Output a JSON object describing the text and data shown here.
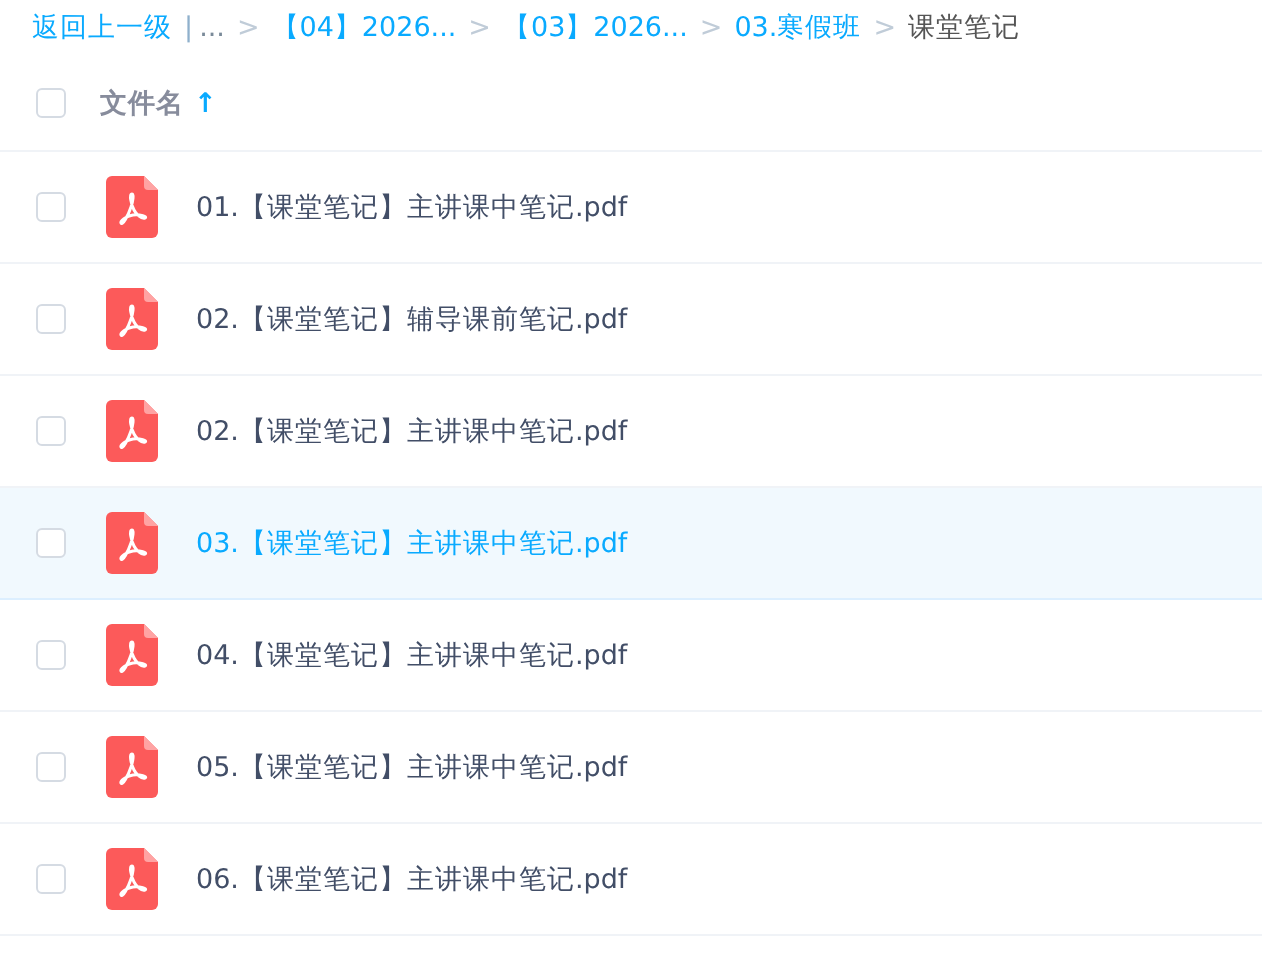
{
  "breadcrumb": [
    {
      "kind": "link",
      "text": "返回上一级"
    },
    {
      "kind": "divider",
      "text": "|"
    },
    {
      "kind": "muted",
      "text": "..."
    },
    {
      "kind": "sep",
      "text": ">"
    },
    {
      "kind": "link",
      "text": "【04】2026..."
    },
    {
      "kind": "sep",
      "text": ">"
    },
    {
      "kind": "link",
      "text": "【03】2026..."
    },
    {
      "kind": "sep",
      "text": ">"
    },
    {
      "kind": "link",
      "text": "03.寒假班"
    },
    {
      "kind": "sep",
      "text": ">"
    },
    {
      "kind": "current",
      "text": "课堂笔记"
    }
  ],
  "header": {
    "checked": false,
    "column": "文件名",
    "sort_arrow": "↑"
  },
  "files": [
    {
      "name": "01.【课堂笔记】主讲课中笔记.pdf",
      "checked": false,
      "hovered": false
    },
    {
      "name": "02.【课堂笔记】辅导课前笔记.pdf",
      "checked": false,
      "hovered": false
    },
    {
      "name": "02.【课堂笔记】主讲课中笔记.pdf",
      "checked": false,
      "hovered": false
    },
    {
      "name": "03.【课堂笔记】主讲课中笔记.pdf",
      "checked": false,
      "hovered": true
    },
    {
      "name": "04.【课堂笔记】主讲课中笔记.pdf",
      "checked": false,
      "hovered": false
    },
    {
      "name": "05.【课堂笔记】主讲课中笔记.pdf",
      "checked": false,
      "hovered": false
    },
    {
      "name": "06.【课堂笔记】主讲课中笔记.pdf",
      "checked": false,
      "hovered": false
    }
  ]
}
